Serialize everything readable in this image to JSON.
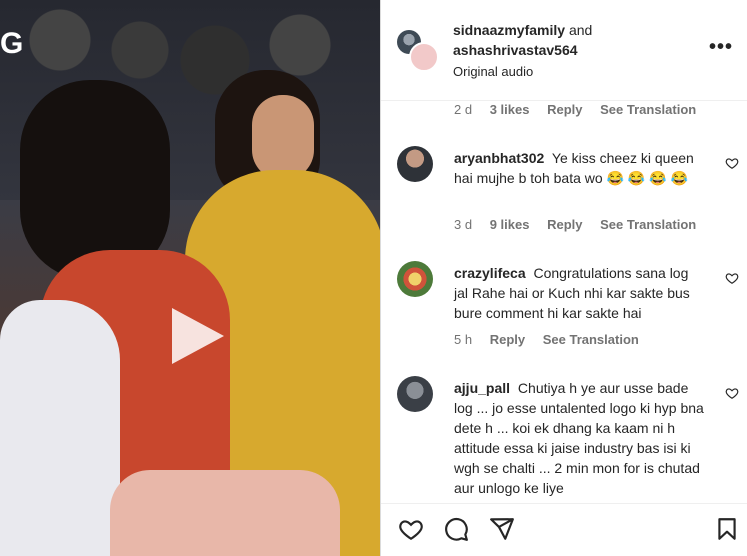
{
  "post": {
    "owner_primary": "sidnaazmyfamily",
    "owner_join": " and",
    "owner_secondary": "ashashrivastav564",
    "audio": "Original audio",
    "brand_glyph": "G"
  },
  "previous_meta": {
    "time": "2 d",
    "likes": "3 likes",
    "reply": "Reply",
    "translate": "See Translation"
  },
  "comments": [
    {
      "username": "aryanbhat302",
      "text": "Ye kiss cheez ki queen hai mujhe b toh bata wo 😂 😂 😂 😂",
      "time": "3 d",
      "likes": "9 likes",
      "reply": "Reply",
      "translate": "See Translation"
    },
    {
      "username": "crazylifeca",
      "text": "Congratulations sana log jal Rahe hai or Kuch nhi kar sakte bus bure comment hi kar sakte hai",
      "time": "5 h",
      "reply": "Reply",
      "translate": "See Translation"
    },
    {
      "username": "ajju_pall",
      "text": "Chutiya h ye aur usse bade log ... jo esse untalented logo ki hyp bna dete h ... koi ek dhang ka kaam ni h attitude essa ki jaise industry bas isi ki wgh se chalti ... 2 min mon for is chutad aur unlogo ke liye"
    }
  ],
  "icons": {
    "more": "more-options-icon",
    "like": "heart-icon",
    "comment": "comment-icon",
    "share": "share-icon",
    "save": "bookmark-icon",
    "play": "play-icon"
  }
}
